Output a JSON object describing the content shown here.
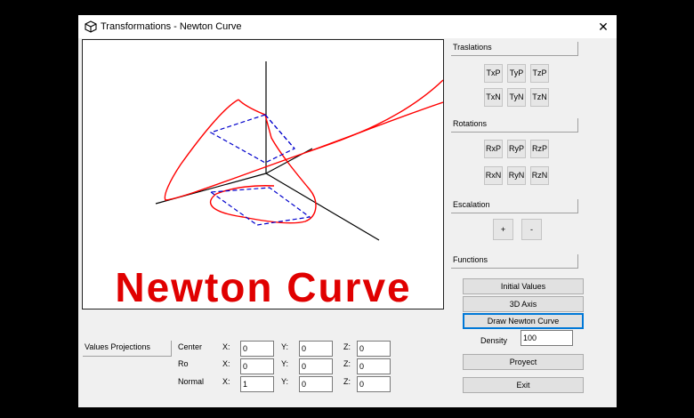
{
  "window": {
    "title": "Transformations - Newton Curve",
    "close_glyph": "✕",
    "icon": "cube-icon"
  },
  "canvas": {
    "title": "Newton Curve",
    "title_color": "#e00000",
    "curve_color": "#ff0000",
    "dashed_color": "#0000cc",
    "axis_color": "#000000"
  },
  "translations": {
    "label": "Traslations",
    "buttons": [
      "TxP",
      "TyP",
      "TzP",
      "TxN",
      "TyN",
      "TzN"
    ]
  },
  "rotations": {
    "label": "Rotations",
    "buttons": [
      "RxP",
      "RyP",
      "RzP",
      "RxN",
      "RyN",
      "RzN"
    ]
  },
  "escalation": {
    "label": "Escalation",
    "plus": "+",
    "minus": "-"
  },
  "functions": {
    "label": "Functions",
    "initial_values": "Initial Values",
    "axis_3d": "3D Axis",
    "draw_newton": "Draw Newton Curve",
    "density_label": "Density",
    "density_value": "100",
    "proyect": "Proyect",
    "exit": "Exit"
  },
  "projections": {
    "label": "Values Projections",
    "rows": [
      {
        "name": "Center",
        "x": "0",
        "y": "0",
        "z": "0"
      },
      {
        "name": "Ro",
        "x": "0",
        "y": "0",
        "z": "0"
      },
      {
        "name": "Normal",
        "x": "1",
        "y": "0",
        "z": "0"
      }
    ],
    "x_label": "X:",
    "y_label": "Y:",
    "z_label": "Z:"
  }
}
